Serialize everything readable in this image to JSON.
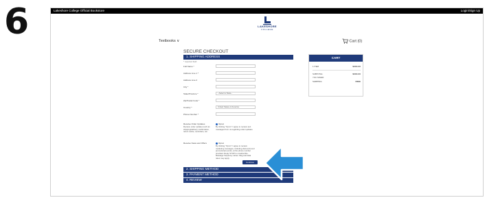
{
  "step": {
    "number": "6"
  },
  "topbar": {
    "store_name": "Lakeshore College Official Bookstore",
    "login": "Login/Sign Up"
  },
  "logo": {
    "name": "LAKESHORE",
    "sub": "COLLEGE"
  },
  "nav": {
    "textbooks": "Textbooks ∨",
    "cart": "Cart (0)"
  },
  "checkout": {
    "title": "SECURE CHECKOUT",
    "section1": "1. SHIPPING ADDRESS",
    "required_note": "* required field",
    "fields": [
      {
        "label": "Full Name *",
        "value": ""
      },
      {
        "label": "Address Line 1 *",
        "value": ""
      },
      {
        "label": "Address Line 2",
        "value": ""
      },
      {
        "label": "City *",
        "value": ""
      },
      {
        "label": "State/Province *",
        "value": "--Select a State--"
      },
      {
        "label": "Zip/Postal Code *",
        "value": ""
      },
      {
        "label": "Country *",
        "value": "United States of America"
      },
      {
        "label": "Phone Number *",
        "value": ""
      }
    ],
    "order_updates": {
      "label": "Receive Order Updates",
      "side_desc": "Receive order updates such as shipping/delivery confirmation, return notice, reminders, etc.",
      "option": "Opt-in",
      "desc": "By clicking \"Opt-in\" I agree to receive text messages from us regarding order updates."
    },
    "news_offers": {
      "label": "Receive News and Offers",
      "option": "Opt-in",
      "desc": "By clicking \"Opt-in\" I agree to receive marketing messages, including discounts and promotional events, at the phone number provided. Reply STOP to unsubscribe. Message frequency varies. Msg and data rates may apply."
    },
    "continue": "Continue",
    "section2": "2. SHIPPING METHOD",
    "section3": "3. PAYMENT METHOD",
    "section4": "4. REVIEW"
  },
  "cart": {
    "title": "CART",
    "rows": [
      {
        "label": "1 ITEM",
        "value": "$XXX.XX"
      },
      {
        "label": "SUBTOTAL:",
        "value": "$XXX.XX"
      },
      {
        "label": "YOU SAVED:",
        "value": ""
      },
      {
        "label": "SHIPPING:",
        "value": "FREE"
      }
    ]
  },
  "colors": {
    "brand": "#1f3a7a",
    "arrow": "#2a8fd6"
  },
  "icons": {
    "cart": "cart-icon",
    "arrow": "arrow-left-icon"
  }
}
